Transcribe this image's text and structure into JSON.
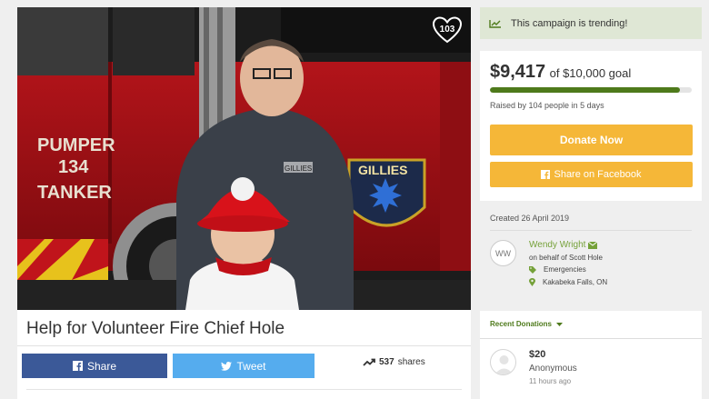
{
  "photo": {
    "heart_count": "103",
    "truck_text": [
      "PUMPER",
      "134",
      "TANKER"
    ],
    "badge_text": "GILLIES",
    "jacket_text": "GILLIES"
  },
  "campaign": {
    "title": "Help for Volunteer Fire Chief Hole"
  },
  "share": {
    "facebook_label": "Share",
    "tweet_label": "Tweet",
    "shares_count": "537",
    "shares_label": "shares"
  },
  "trending": {
    "text": "This campaign is trending!"
  },
  "funding": {
    "raised": "$9,417",
    "goal_text": "of $10,000 goal",
    "progress_fraction": 0.9417,
    "raised_by": "Raised by 104 people in 5 days",
    "donate_label": "Donate Now",
    "facebook_label": "Share on Facebook"
  },
  "organizer": {
    "created": "Created 26 April 2019",
    "initials": "WW",
    "name": "Wendy Wright",
    "behalf": "on behalf of Scott Hole",
    "category": "Emergencies",
    "location": "Kakabeka Falls, ON"
  },
  "donations": {
    "header": "Recent Donations",
    "items": [
      {
        "amount": "$20",
        "name": "Anonymous",
        "time": "11 hours ago"
      }
    ]
  },
  "colors": {
    "accent_green": "#4e7a1b",
    "donate_orange": "#f5b738",
    "facebook_blue": "#3b5998",
    "twitter_blue": "#55acee",
    "trending_bg": "#dfe7d5"
  }
}
